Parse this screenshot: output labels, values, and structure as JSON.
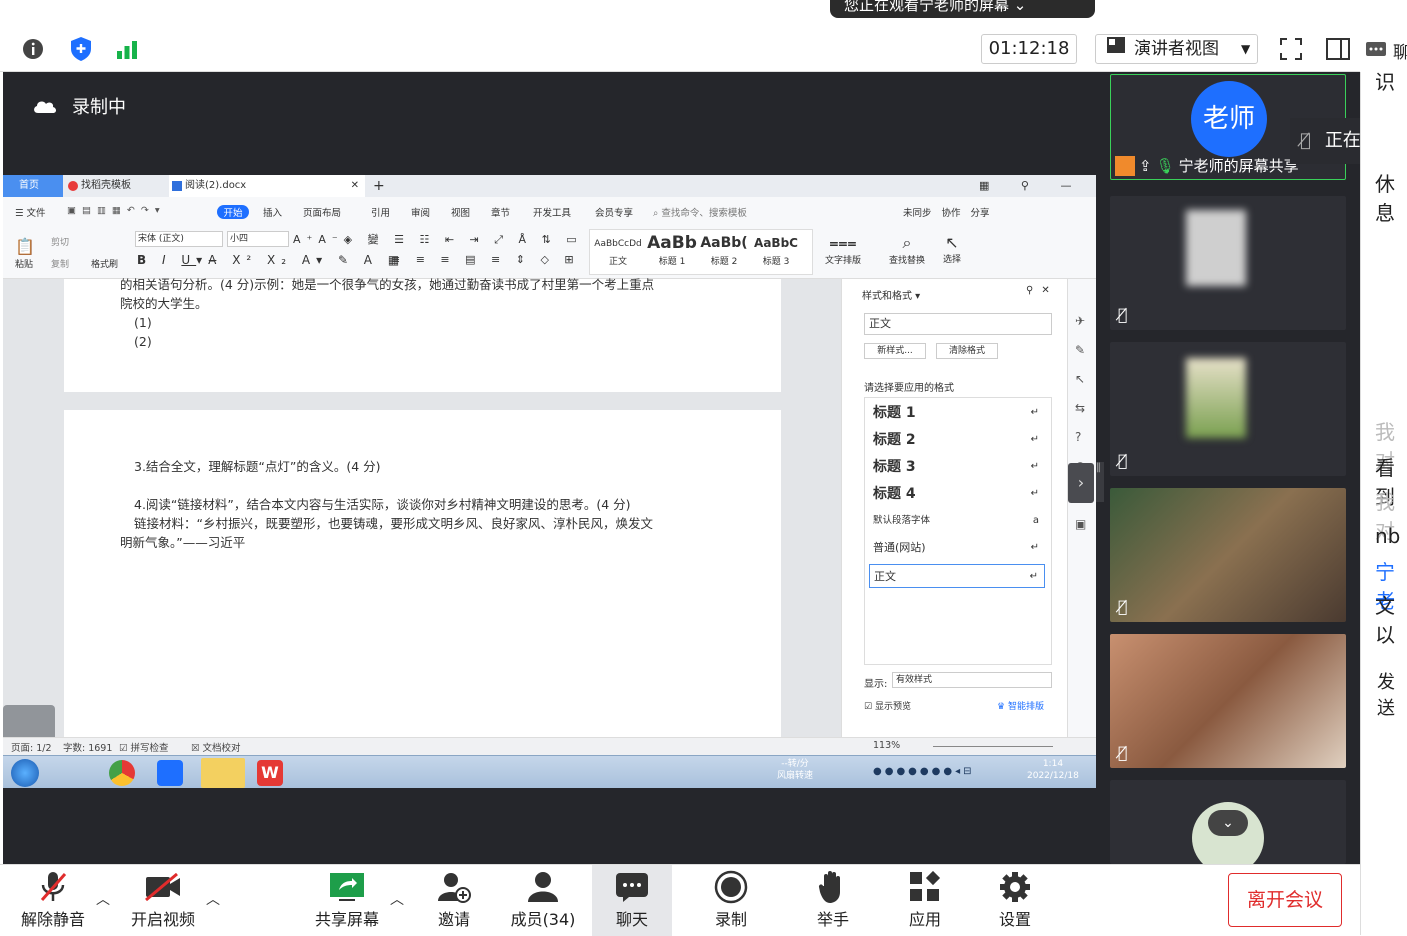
{
  "banner": {
    "text": "您正在观看宁老师的屏幕"
  },
  "toolbar": {
    "timer": "01:12:18",
    "view_label": "演讲者视图",
    "chat_cut": "聊"
  },
  "recording": {
    "label": "录制中"
  },
  "wps": {
    "tabs": [
      "首页",
      "找稻壳模板",
      "阅读(2).docx"
    ],
    "menu": [
      "文件",
      "开始",
      "插入",
      "页面布局",
      "引用",
      "审阅",
      "视图",
      "章节",
      "开发工具",
      "会员专享"
    ],
    "search": "查找命令、搜索模板",
    "right_actions": [
      "未同步",
      "协作",
      "分享"
    ],
    "font": "宋体 (正文)",
    "size": "小四",
    "clipboard": [
      "剪切",
      "复制",
      "粘贴",
      "格式刷"
    ],
    "style_previews": [
      {
        "sample": "AaBbCcDd",
        "name": "正文"
      },
      {
        "sample": "AaBb",
        "name": "标题 1"
      },
      {
        "sample": "AaBb(",
        "name": "标题 2"
      },
      {
        "sample": "AaBbC",
        "name": "标题 3"
      }
    ],
    "ribbon_right": [
      "文字排版",
      "查找替换",
      "选择"
    ]
  },
  "document": {
    "page1_lines": [
      "的相关语句分析。(4 分)示例：她是一个很争气的女孩，她通过勤奋读书成了村里第一个考上重点",
      "院校的大学生。",
      "(1)",
      "(2)"
    ],
    "page2_lines": [
      "3.结合全文，理解标题“点灯”的含义。(4 分)",
      "4.阅读“链接材料”，结合本文内容与生活实际，谈谈你对乡村精神文明建设的思考。(4 分)",
      "链接材料：“乡村振兴，既要塑形，也要铸魂，要形成文明乡风、良好家风、淳朴民风，焕发文",
      "明新气象。”——习近平"
    ]
  },
  "style_pane": {
    "title": "样式和格式",
    "current": "正文",
    "new_style": "新样式...",
    "clear_format": "清除格式",
    "prompt": "请选择要应用的格式",
    "styles": [
      "标题 1",
      "标题 2",
      "标题 3",
      "标题 4",
      "默认段落字体",
      "普通(网站)",
      "正文"
    ],
    "show_label": "显示:",
    "show_value": "有效样式",
    "preview_label": "显示预览",
    "smart": "智能排版"
  },
  "statusbar": {
    "page": "页面: 1/2",
    "words": "字数: 1691",
    "spell": "拼写检查",
    "proof": "文档校对",
    "zoom": "113%"
  },
  "taskbar": {
    "speed1": "--转/分",
    "speed2": "风扇转速",
    "time": "1:14",
    "date": "2022/12/18"
  },
  "participants": {
    "teacher_avatar": "老师",
    "teacher_label": "宁老师的屏幕共享",
    "speaking": "正在讲"
  },
  "chat": {
    "lines": [
      "识",
      "休息",
      "我对",
      "看到",
      "我对",
      "nb",
      "宁老",
      "文以",
      "发送"
    ]
  },
  "bottom": {
    "unmute": "解除静音",
    "video": "开启视频",
    "share": "共享屏幕",
    "invite": "邀请",
    "members": "成员(34)",
    "chat": "聊天",
    "record": "录制",
    "raise": "举手",
    "apps": "应用",
    "settings": "设置",
    "leave": "离开会议"
  },
  "colors": {
    "accent": "#1e6fff",
    "leave": "#e02c2c",
    "dark": "#25262b"
  }
}
